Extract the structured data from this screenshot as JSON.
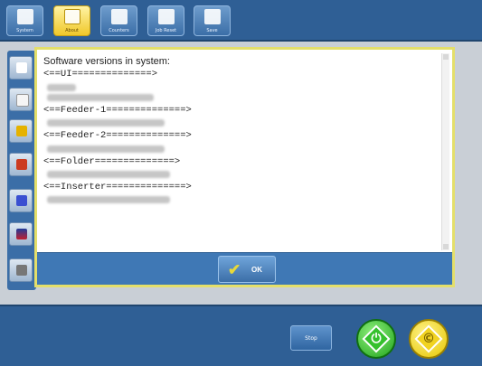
{
  "toolbar": {
    "buttons": [
      {
        "label": "System",
        "icon": "system-icon",
        "active": false
      },
      {
        "label": "About",
        "icon": "about-icon",
        "active": true
      },
      {
        "label": "Counters",
        "icon": "counters-icon",
        "active": false
      },
      {
        "label": "Job Reset",
        "icon": "job-reset-icon",
        "active": false
      },
      {
        "label": "Save",
        "icon": "save-icon",
        "active": false
      }
    ]
  },
  "dialog": {
    "title_line": "Software versions in system:",
    "lines": [
      {
        "kind": "text",
        "value": "<==UI==============>"
      },
      {
        "kind": "blur"
      },
      {
        "kind": "blur"
      },
      {
        "kind": "text",
        "value": "<==Feeder-1==============>"
      },
      {
        "kind": "blur"
      },
      {
        "kind": "text",
        "value": "<==Feeder-2==============>"
      },
      {
        "kind": "blur"
      },
      {
        "kind": "text",
        "value": "<==Folder==============>"
      },
      {
        "kind": "blur"
      },
      {
        "kind": "text",
        "value": "<==Inserter==============>"
      },
      {
        "kind": "blur"
      }
    ],
    "ok_label": "OK"
  },
  "bottom": {
    "stop_label": "Stop",
    "start_icon": "start-icon",
    "clear_icon": "clear-icon"
  },
  "colors": {
    "bar_blue": "#2f5f95",
    "dialog_border": "#e4df6a",
    "start_green": "#1fa31a",
    "clear_yellow": "#e6c700"
  }
}
